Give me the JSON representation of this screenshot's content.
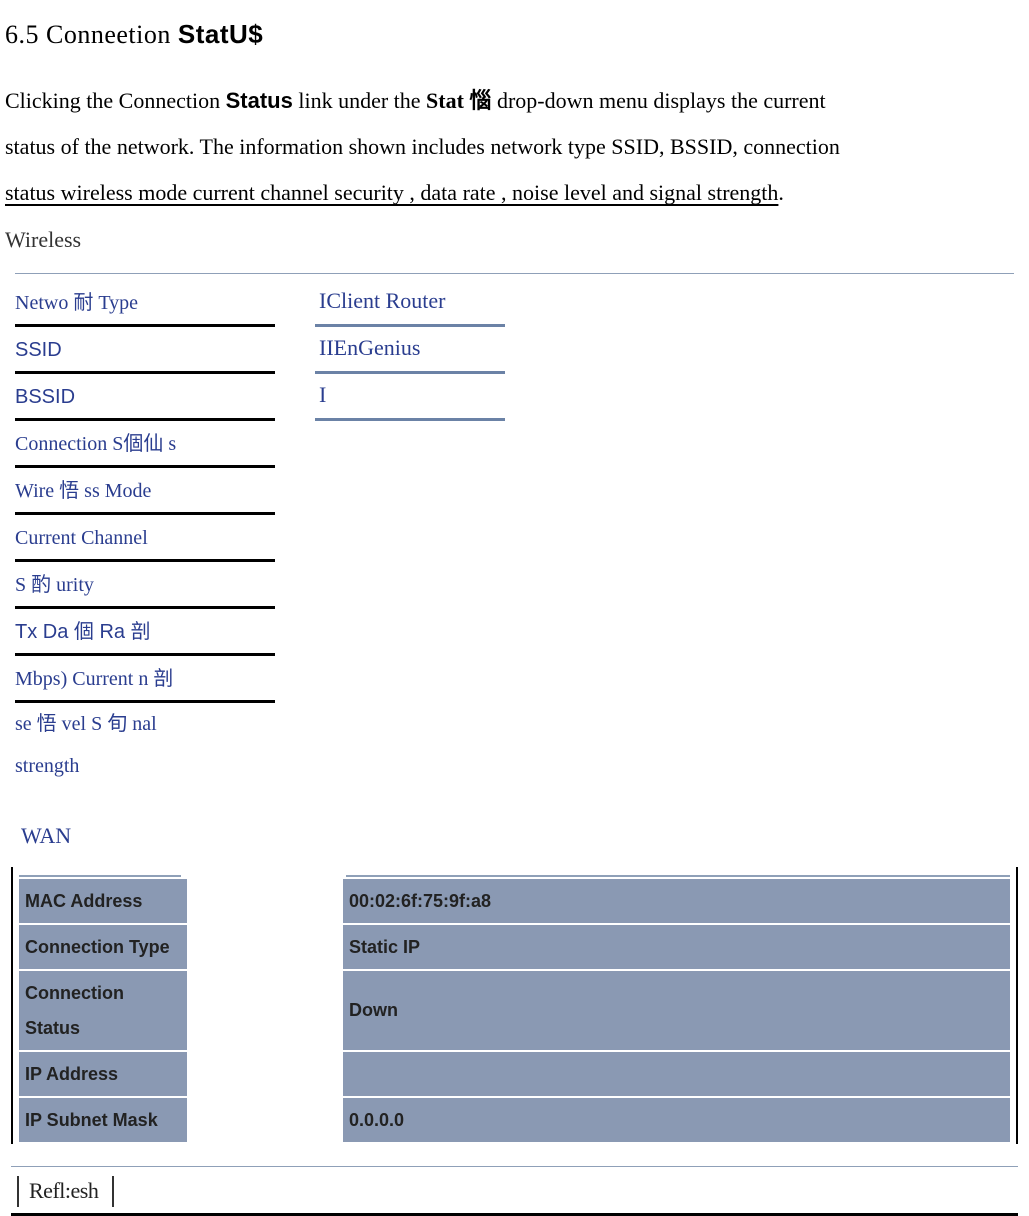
{
  "section": {
    "number": "6.5",
    "title_main": "Conneetion",
    "title_sub": "StatU$"
  },
  "paragraph": {
    "line1_a": "Clicking the Connection ",
    "line1_b": "Status",
    "line1_c": " link under the ",
    "line1_d": "Stat 惱 ",
    "line1_e": " drop-down  menu displays the current",
    "line2": "status of the network. The information shown includes network type  SSID, BSSID, connection",
    "line3": "status  wireless mode  current channel  security , data rate , noise level and signal strength"
  },
  "wireless": {
    "heading": "Wireless",
    "rows": [
      {
        "label": "Netwo 耐 Type",
        "marker": "I",
        "value": "Client Router",
        "bordered": true
      },
      {
        "label": "SSID",
        "marker": "II",
        "value": "EnGenius",
        "bordered": true
      },
      {
        "label": "BSSID",
        "marker": "I",
        "value": "",
        "bordered": true
      },
      {
        "label": "Connection S個仙 s",
        "marker": "",
        "value": "",
        "bordered": false
      },
      {
        "label": "Wire 悟 ss Mode",
        "marker": "",
        "value": "",
        "bordered": false
      },
      {
        "label": "Current Channel",
        "marker": "",
        "value": "",
        "bordered": false
      },
      {
        "label": "S 酌 urity",
        "marker": "",
        "value": "",
        "bordered": false
      },
      {
        "label": "Tx Da 個 Ra 剖",
        "marker": "",
        "value": "",
        "bordered": false
      },
      {
        "label": "Mbps) Current n 剖",
        "marker": "",
        "value": "",
        "bordered": false
      }
    ],
    "extra_rows": [
      "se 悟 vel S 旬 nal",
      "strength"
    ]
  },
  "wan": {
    "heading": "WAN",
    "rows": [
      {
        "label": "MAC Address",
        "value": "00:02:6f:75:9f:a8"
      },
      {
        "label": "Connection Type",
        "value": "Static IP"
      },
      {
        "label": "Connection Status",
        "value": "Down"
      },
      {
        "label": "IP Address",
        "value": ""
      },
      {
        "label": "IP Subnet Mask",
        "value": "0.0.0.0"
      }
    ]
  },
  "refresh": {
    "label": "Refl:esh"
  }
}
